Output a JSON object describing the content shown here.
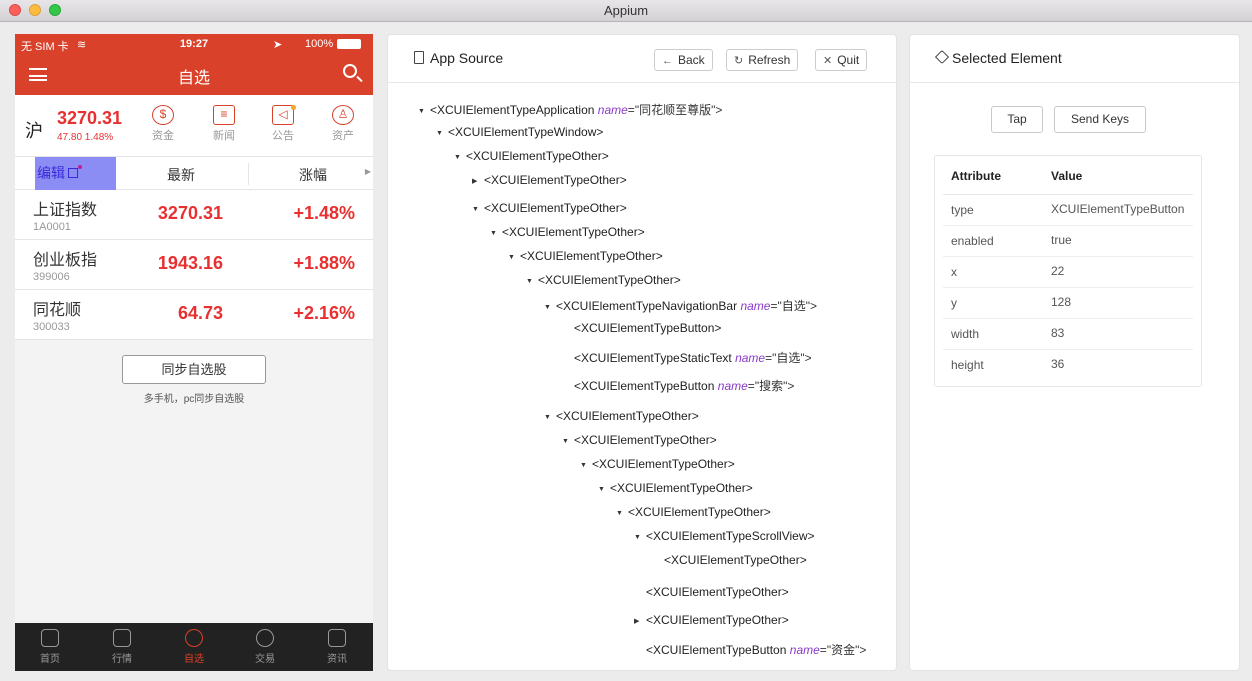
{
  "window": {
    "title": "Appium"
  },
  "phone": {
    "status": {
      "carrier": "无 SIM 卡",
      "time": "19:27",
      "battery": "100%"
    },
    "nav_title": "自选",
    "index": {
      "label": "沪",
      "value": "3270.31",
      "change": "47.80 1.48%"
    },
    "quick_links": [
      {
        "label": "资金",
        "icon": "dollar-icon"
      },
      {
        "label": "新闻",
        "icon": "news-icon"
      },
      {
        "label": "公告",
        "icon": "speaker-icon"
      },
      {
        "label": "资产",
        "icon": "user-icon"
      }
    ],
    "list_header": {
      "edit": "编辑",
      "latest": "最新",
      "change": "涨幅"
    },
    "stocks": [
      {
        "name": "上证指数",
        "code": "1A0001",
        "price": "3270.31",
        "change": "+1.48%"
      },
      {
        "name": "创业板指",
        "code": "399006",
        "price": "1943.16",
        "change": "+1.88%"
      },
      {
        "name": "同花顺",
        "code": "300033",
        "price": "64.73",
        "change": "+2.16%"
      }
    ],
    "sync_button": "同步自选股",
    "sync_sub": "多手机，pc同步自选股",
    "tabs": [
      {
        "label": "首页",
        "icon": "home-icon"
      },
      {
        "label": "行情",
        "icon": "chart-icon"
      },
      {
        "label": "自选",
        "icon": "favorite-icon",
        "active": true
      },
      {
        "label": "交易",
        "icon": "trade-icon"
      },
      {
        "label": "资讯",
        "icon": "news-icon"
      }
    ]
  },
  "source_panel": {
    "title": "App Source",
    "buttons": {
      "back": "Back",
      "refresh": "Refresh",
      "quit": "Quit"
    },
    "tree": [
      {
        "tag": "<XCUIElementTypeApplication",
        "attr": "name",
        "value": "\"同花顺至尊版\"",
        "close": ">",
        "toggle": "▼"
      },
      {
        "tag": "<XCUIElementTypeWindow>",
        "attr": "",
        "value": "",
        "close": "",
        "toggle": "▼"
      },
      {
        "tag": "<XCUIElementTypeOther>",
        "attr": "",
        "value": "",
        "close": "",
        "toggle": "▼"
      },
      {
        "tag": "<XCUIElementTypeOther>",
        "attr": "",
        "value": "",
        "close": "",
        "toggle": "▶"
      },
      {
        "tag": "<XCUIElementTypeOther>",
        "attr": "",
        "value": "",
        "close": "",
        "toggle": "▼"
      },
      {
        "tag": "<XCUIElementTypeOther>",
        "attr": "",
        "value": "",
        "close": "",
        "toggle": "▼"
      },
      {
        "tag": "<XCUIElementTypeOther>",
        "attr": "",
        "value": "",
        "close": "",
        "toggle": "▼"
      },
      {
        "tag": "<XCUIElementTypeOther>",
        "attr": "",
        "value": "",
        "close": "",
        "toggle": "▼"
      },
      {
        "tag": "<XCUIElementTypeNavigationBar",
        "attr": "name",
        "value": "\"自选\"",
        "close": ">",
        "toggle": "▼"
      },
      {
        "tag": "<XCUIElementTypeButton>",
        "attr": "",
        "value": "",
        "close": "",
        "toggle": ""
      },
      {
        "tag": "<XCUIElementTypeStaticText",
        "attr": "name",
        "value": "\"自选\"",
        "close": ">",
        "toggle": ""
      },
      {
        "tag": "<XCUIElementTypeButton",
        "attr": "name",
        "value": "\"搜索\"",
        "close": ">",
        "toggle": ""
      },
      {
        "tag": "<XCUIElementTypeOther>",
        "attr": "",
        "value": "",
        "close": "",
        "toggle": "▼"
      },
      {
        "tag": "<XCUIElementTypeOther>",
        "attr": "",
        "value": "",
        "close": "",
        "toggle": "▼"
      },
      {
        "tag": "<XCUIElementTypeOther>",
        "attr": "",
        "value": "",
        "close": "",
        "toggle": "▼"
      },
      {
        "tag": "<XCUIElementTypeOther>",
        "attr": "",
        "value": "",
        "close": "",
        "toggle": "▼"
      },
      {
        "tag": "<XCUIElementTypeOther>",
        "attr": "",
        "value": "",
        "close": "",
        "toggle": "▼"
      },
      {
        "tag": "<XCUIElementTypeScrollView>",
        "attr": "",
        "value": "",
        "close": "",
        "toggle": "▼"
      },
      {
        "tag": "<XCUIElementTypeOther>",
        "attr": "",
        "value": "",
        "close": "",
        "toggle": ""
      },
      {
        "tag": "<XCUIElementTypeOther>",
        "attr": "",
        "value": "",
        "close": "",
        "toggle": ""
      },
      {
        "tag": "<XCUIElementTypeOther>",
        "attr": "",
        "value": "",
        "close": "",
        "toggle": "▶"
      },
      {
        "tag": "<XCUIElementTypeButton",
        "attr": "name",
        "value": "\"资金\"",
        "close": ">",
        "toggle": ""
      }
    ]
  },
  "selected_panel": {
    "title": "Selected Element",
    "actions": {
      "tap": "Tap",
      "send_keys": "Send Keys"
    },
    "headers": {
      "attribute": "Attribute",
      "value": "Value"
    },
    "attributes": [
      {
        "key": "type",
        "value": "XCUIElementTypeButton"
      },
      {
        "key": "enabled",
        "value": "true"
      },
      {
        "key": "x",
        "value": "22"
      },
      {
        "key": "y",
        "value": "128"
      },
      {
        "key": "width",
        "value": "83"
      },
      {
        "key": "height",
        "value": "36"
      }
    ]
  }
}
